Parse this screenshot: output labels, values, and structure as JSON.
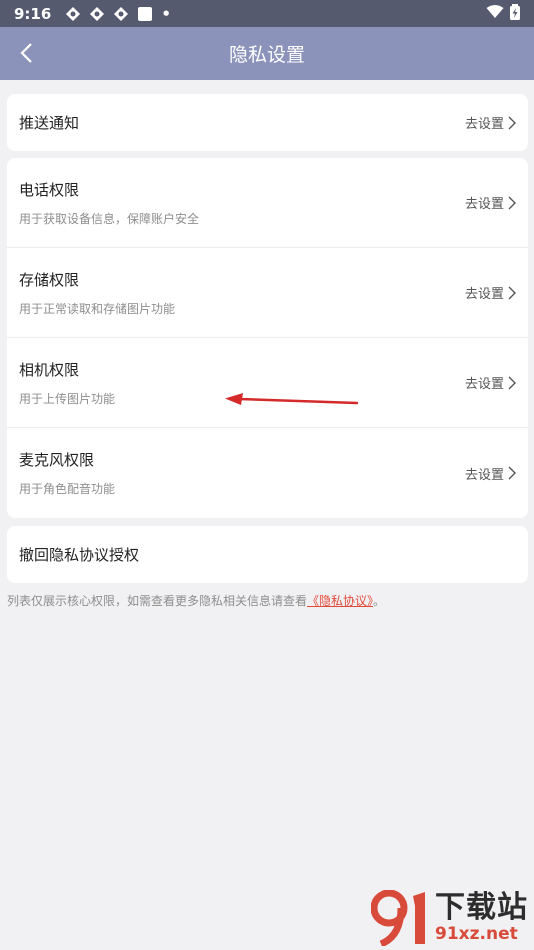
{
  "status_bar": {
    "time": "9:16",
    "dot": "•"
  },
  "header": {
    "title": "隐私设置"
  },
  "push_notification": {
    "label": "推送通知",
    "action": "去设置"
  },
  "permissions": [
    {
      "label": "电话权限",
      "desc": "用于获取设备信息，保障账户安全",
      "action": "去设置"
    },
    {
      "label": "存储权限",
      "desc": "用于正常读取和存储图片功能",
      "action": "去设置"
    },
    {
      "label": "相机权限",
      "desc": "用于上传图片功能",
      "action": "去设置"
    },
    {
      "label": "麦克风权限",
      "desc": "用于角色配音功能",
      "action": "去设置"
    }
  ],
  "revoke": {
    "label": "撤回隐私协议授权"
  },
  "footer_note": {
    "text": "列表仅展示核心权限，如需查看更多隐私相关信息请查看",
    "link": "《隐私协议》",
    "end": "。"
  },
  "watermark": {
    "cn": "下载站",
    "en": "91xz.net"
  },
  "colors": {
    "header_bg": "#8c93ba",
    "status_bg": "#555a6e",
    "page_bg": "#f1f1f3",
    "link": "#e24a3a",
    "annotation_arrow": "#d42a2a"
  }
}
